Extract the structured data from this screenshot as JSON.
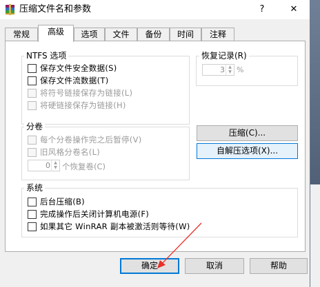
{
  "window": {
    "title": "压缩文件名和参数",
    "help_glyph": "?",
    "close_glyph": "✕"
  },
  "tabs": [
    "常规",
    "高级",
    "选项",
    "文件",
    "备份",
    "时间",
    "注释"
  ],
  "ntfs": {
    "label": "NTFS 选项",
    "items": [
      {
        "label": "保存文件安全数据(S)",
        "checked": false,
        "enabled": true
      },
      {
        "label": "保存文件流数据(T)",
        "checked": false,
        "enabled": true
      },
      {
        "label": "将符号链接保存为链接(L)",
        "checked": false,
        "enabled": false
      },
      {
        "label": "将硬链接保存为链接(H)",
        "checked": false,
        "enabled": false
      }
    ]
  },
  "recovery": {
    "label": "恢复记录(R)",
    "value": "3",
    "unit": "%"
  },
  "volumes": {
    "label": "分卷",
    "items": [
      {
        "label": "每个分卷操作完之后暂停(V)",
        "checked": false,
        "enabled": false
      },
      {
        "label": "旧风格分卷名(L)",
        "checked": false,
        "enabled": false
      }
    ],
    "recovery_count": "0",
    "recovery_label": "个恢复卷(C)"
  },
  "side_buttons": {
    "compress": "压缩(C)...",
    "sfx": "自解压选项(X)..."
  },
  "system": {
    "label": "系统",
    "items": [
      {
        "label": "后台压缩(B)",
        "checked": false
      },
      {
        "label": "完成操作后关闭计算机电源(F)",
        "checked": false
      },
      {
        "label": "如果其它 WinRAR 副本被激活则等待(W)",
        "checked": false
      }
    ]
  },
  "footer": {
    "ok": "确定",
    "cancel": "取消",
    "help": "帮助"
  },
  "colors": {
    "accent": "#0078d7",
    "annotation_arrow": "#e8312a"
  }
}
